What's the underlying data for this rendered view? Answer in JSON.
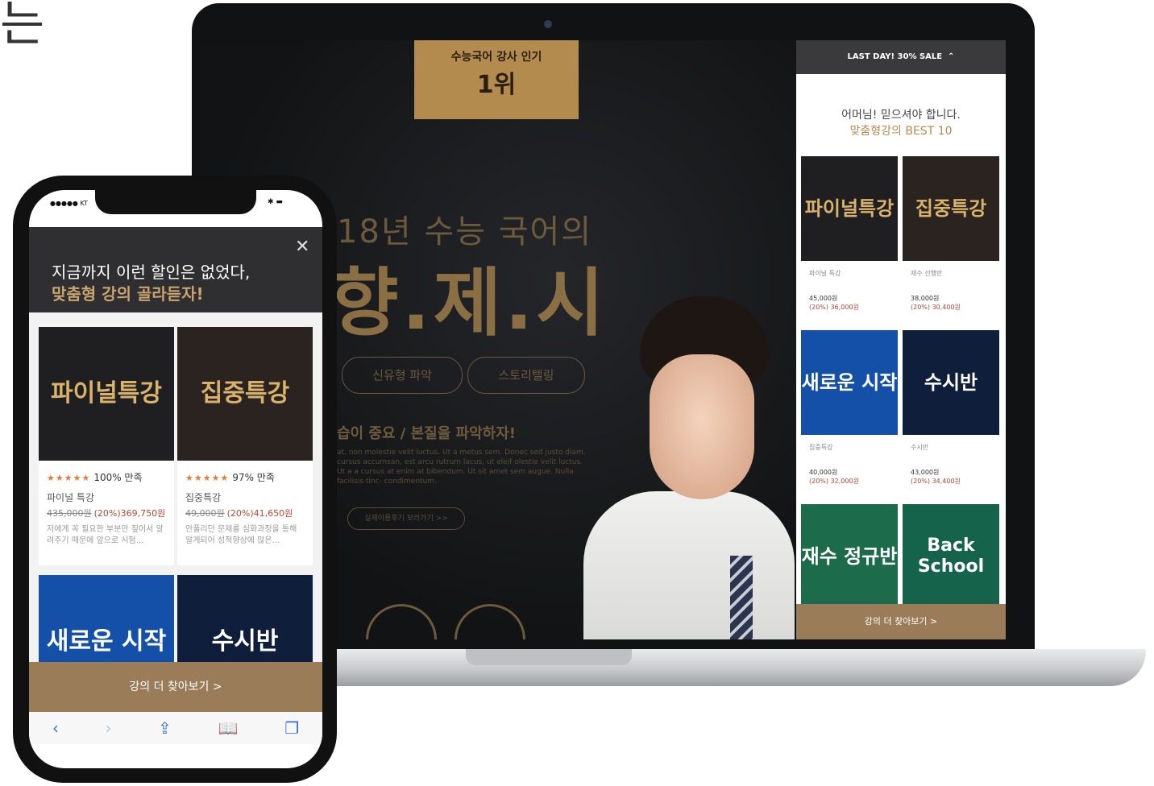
{
  "wall_text": "는",
  "laptop": {
    "badge": {
      "subtitle": "수능국어 강사 인기",
      "rank": "1위"
    },
    "hero_sub": "18년 수능 국어의",
    "hero_main": "향.제.시",
    "pills": [
      "신유형 파악",
      "스토리텔링"
    ],
    "hero_line": "습이 중요 / 본질을 파악하자!",
    "lorem": "at, non molestie velit luctus. Ut a metus sem. Donec sed justo diam. cursus accumsan, est arcu rutrum lacus, ut eleif olestie velit luctus. Ut a a cursus at enim at bibendum. Ut sit amet sem augue. Nulla facilisis tinc- condimentum.",
    "more_button": "실제이용후기 보러가기 >>",
    "panel": {
      "top_label": "LAST DAY! 30% SALE",
      "heading_1": "어머님! 믿으셔야 합니다.",
      "heading_2": "맞춤형강의 BEST 10",
      "products": [
        {
          "thumb": "파이널특강",
          "name": "파이널 특강",
          "orig": "45,000원",
          "sale": "(20%) 36,000원",
          "bg": "#1f1f22",
          "fg": "#d9b36b"
        },
        {
          "thumb": "집중특강",
          "name": "재수 선행반",
          "orig": "38,000원",
          "sale": "(20%) 30,400원",
          "bg": "#2a2320",
          "fg": "#d9b36b"
        },
        {
          "thumb": "새로운 시작",
          "name": "집중특강",
          "orig": "40,000원",
          "sale": "(20%) 32,000원",
          "bg": "#1550a8",
          "fg": "#ffffff"
        },
        {
          "thumb": "수시반",
          "name": "수시반",
          "orig": "43,000원",
          "sale": "(20%) 34,400원",
          "bg": "#0f1e3a",
          "fg": "#ffffff"
        },
        {
          "thumb": "재수 정규반",
          "name": "",
          "orig": "",
          "sale": "",
          "bg": "#1c6b4a",
          "fg": "#ffffff"
        },
        {
          "thumb": "Back School",
          "name": "",
          "orig": "",
          "sale": "",
          "bg": "#14634a",
          "fg": "#ffffff"
        }
      ],
      "bottom_button": "강의 더 찾아보기 >"
    }
  },
  "phone": {
    "carrier": "●●●●● KT",
    "status_right": "✱ ▬",
    "title_1": "지금까지 이런 할인은 없었다,",
    "title_2": "맞춤형 강의 골라듣자!",
    "cards": [
      {
        "thumb": "파이널특강",
        "stars": "★★★★★",
        "satisfaction": "100% 만족",
        "name": "파이널 특강",
        "orig": "435,000원",
        "sale": "(20%)369,750원",
        "desc": "저에게 꼭 필요한 부분만 짚어서 알려주기 때문에 앞으로 시험...",
        "bg": "#1f1f22",
        "fg": "#d9b36b"
      },
      {
        "thumb": "집중특강",
        "stars": "★★★★★",
        "satisfaction": "97% 만족",
        "name": "집중특강",
        "orig": "49,000원",
        "sale": "(20%)41,650원",
        "desc": "안풀리던 문제를 심화과정을 통해 알게되어 성적향상에 많은...",
        "bg": "#2a2320",
        "fg": "#d9b36b"
      },
      {
        "thumb": "새로운 시작",
        "bg": "#1550a8",
        "fg": "#ffffff"
      },
      {
        "thumb": "수시반",
        "bg": "#0f1e3a",
        "fg": "#ffffff"
      }
    ],
    "more_button": "강의 더 찾아보기 >",
    "toolbar": [
      "‹",
      "›",
      "⇪",
      "📖",
      "❐"
    ]
  }
}
